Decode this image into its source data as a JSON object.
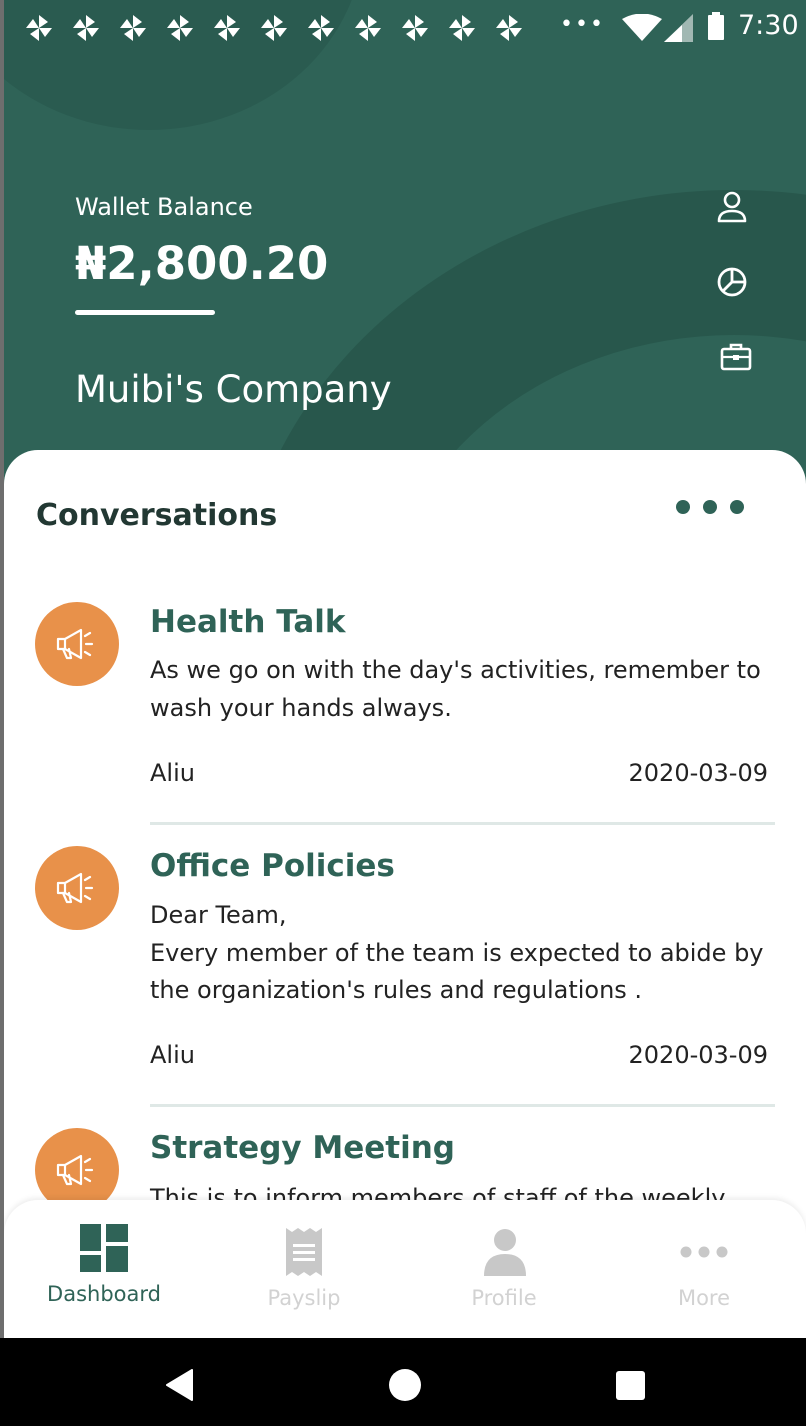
{
  "status_bar": {
    "time": "7:30",
    "overflow_dots": "•••",
    "notification_icons": [
      "pinwheel-icon",
      "pinwheel-icon",
      "pinwheel-icon",
      "pinwheel-icon",
      "pinwheel-icon",
      "pinwheel-icon",
      "pinwheel-icon",
      "pinwheel-icon",
      "pinwheel-icon",
      "pinwheel-icon",
      "pinwheel-icon"
    ]
  },
  "header": {
    "wallet_label": "Wallet Balance",
    "wallet_amount": "₦2,800.20",
    "company_name": "Muibi's Company",
    "side_icons": [
      "user-icon",
      "pie-chart-icon",
      "briefcase-icon"
    ]
  },
  "conversations": {
    "title": "Conversations",
    "items": [
      {
        "title": "Health Talk",
        "body": "As we go on with the day's activities, remember to wash your hands always.",
        "author": "Aliu",
        "date": "2020-03-09",
        "icon": "megaphone-icon"
      },
      {
        "title": "Office Policies",
        "body": "Dear Team,\nEvery member of the team is expected to abide by the organization's rules and regulations .",
        "author": "Aliu",
        "date": "2020-03-09",
        "icon": "megaphone-icon"
      },
      {
        "title": "Strategy Meeting",
        "body": "This is to inform members of staff of the weekly",
        "author": "",
        "date": "",
        "icon": "megaphone-icon"
      }
    ]
  },
  "tabs": [
    {
      "label": "Dashboard",
      "icon": "dashboard-icon",
      "active": true
    },
    {
      "label": "Payslip",
      "icon": "receipt-icon",
      "active": false
    },
    {
      "label": "Profile",
      "icon": "person-icon",
      "active": false
    },
    {
      "label": "More",
      "icon": "more-dots-icon",
      "active": false
    }
  ],
  "colors": {
    "primary": "#2f6357",
    "accent": "#e8914a",
    "inactive": "#c8c8c8"
  }
}
